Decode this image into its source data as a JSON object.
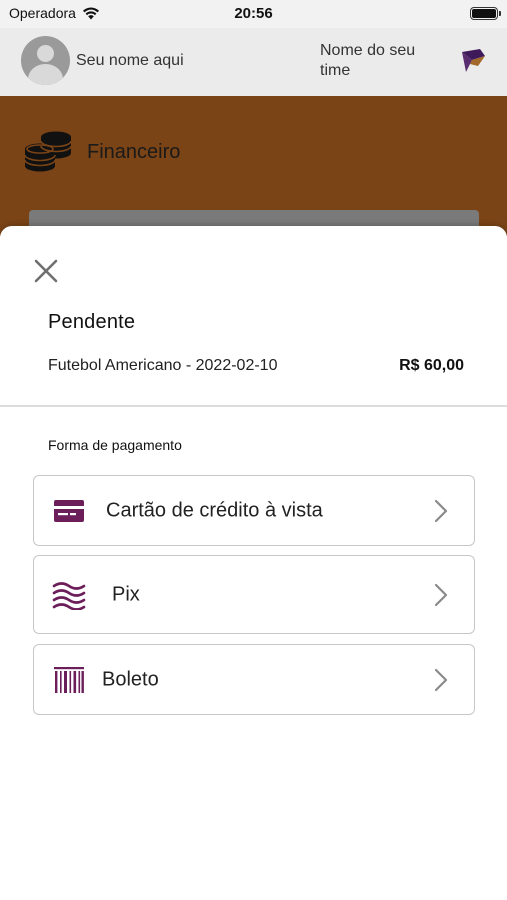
{
  "status_bar": {
    "carrier": "Operadora",
    "time": "20:56"
  },
  "header": {
    "user_name": "Seu nome aqui",
    "team_name": "Nome do seu time"
  },
  "section": {
    "title": "Financeiro"
  },
  "sheet": {
    "title": "Pendente",
    "item_description": "Futebol Americano - 2022-02-10",
    "item_price": "R$ 60,00",
    "payment_label": "Forma de pagamento",
    "options": [
      {
        "label": "Cartão de crédito à vista",
        "icon": "credit-card-icon"
      },
      {
        "label": "Pix",
        "icon": "pix-waves-icon"
      },
      {
        "label": "Boleto",
        "icon": "barcode-icon"
      }
    ]
  },
  "colors": {
    "accent": "#6b1e5a",
    "hero_bg": "#7b4416"
  }
}
